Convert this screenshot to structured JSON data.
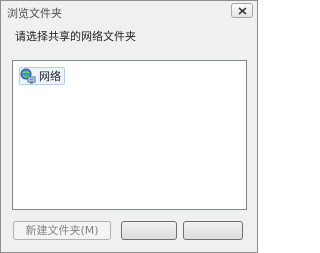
{
  "window": {
    "title": "浏览文件夹"
  },
  "prompt": "请选择共享的网络文件夹",
  "tree": {
    "items": [
      {
        "label": "网络",
        "icon": "network-icon"
      }
    ]
  },
  "buttons": {
    "new_folder_label": "新建文件夹(M)",
    "ok_label": "",
    "cancel_label": ""
  }
}
